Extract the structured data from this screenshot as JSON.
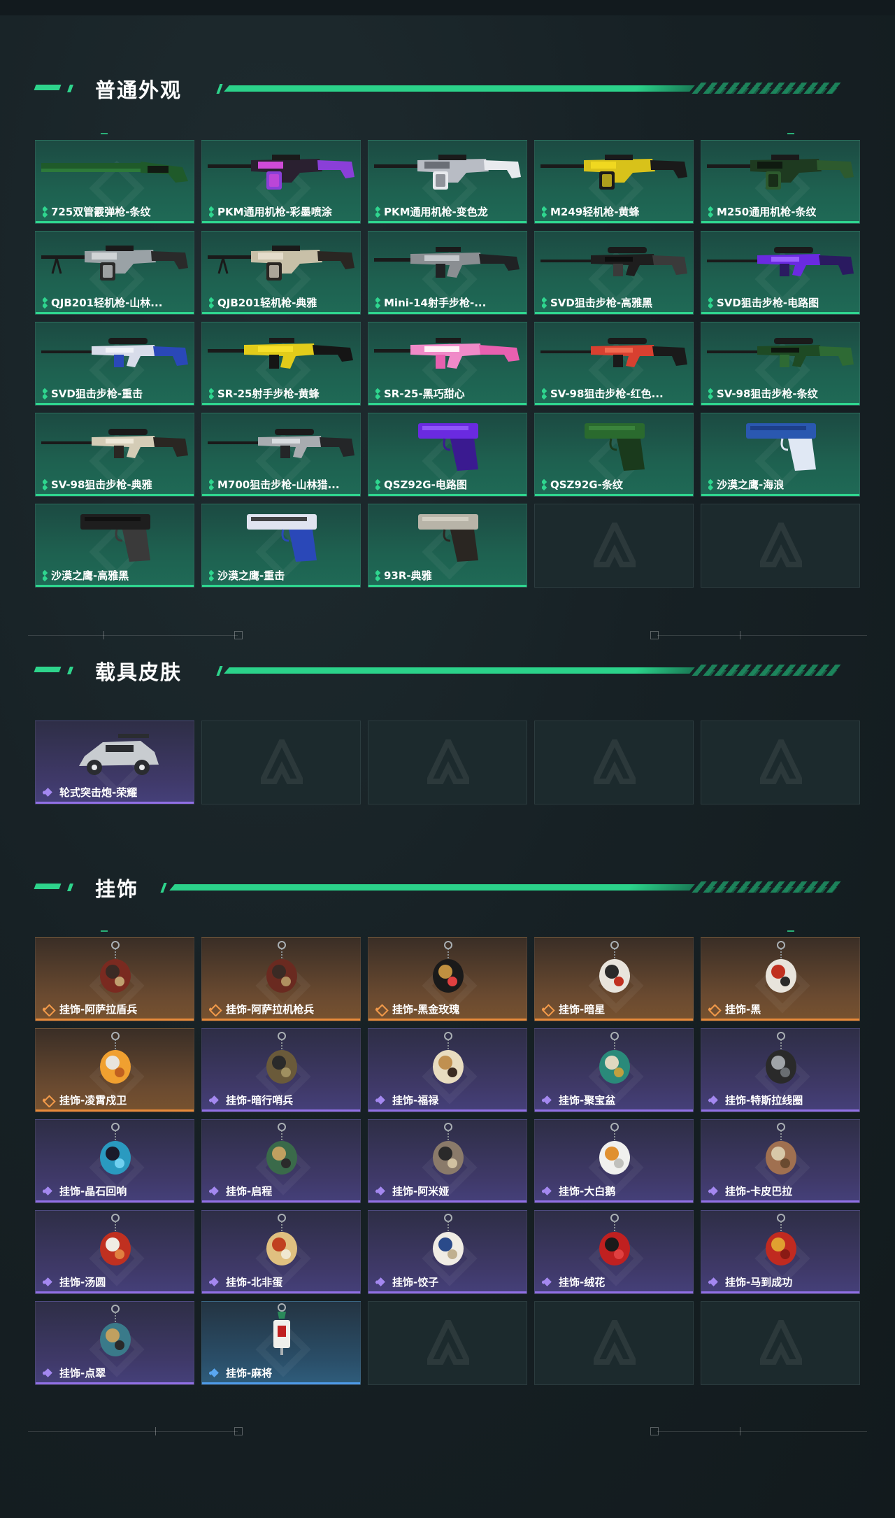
{
  "sections": {
    "weapons": {
      "title": "普通外观",
      "items": [
        {
          "label": "725双管霰弹枪-条纹",
          "type": "shotgun",
          "colors": [
            "#1f5a2a",
            "#2d7a3a",
            "#121a12"
          ]
        },
        {
          "label": "PKM通用机枪-彩墨喷涂",
          "type": "mg",
          "colors": [
            "#2a2030",
            "#8a3fd8",
            "#d04ad8"
          ]
        },
        {
          "label": "PKM通用机枪-变色龙",
          "type": "mg",
          "colors": [
            "#b8bcc4",
            "#e8eaee",
            "#6a6e76"
          ]
        },
        {
          "label": "M249轻机枪-黄蜂",
          "type": "mg",
          "colors": [
            "#d8c21a",
            "#1a1a1a",
            "#f0d820"
          ]
        },
        {
          "label": "M250通用机枪-条纹",
          "type": "mg",
          "colors": [
            "#1e3a20",
            "#2d5a2e",
            "#0f1a10"
          ]
        },
        {
          "label": "QJB201轻机枪-山林...",
          "type": "lmg",
          "colors": [
            "#9aa2a6",
            "#2a2a2a",
            "#d0d4d6"
          ]
        },
        {
          "label": "QJB201轻机枪-典雅",
          "type": "lmg",
          "colors": [
            "#c8c0a8",
            "#2a2622",
            "#e4dccb"
          ]
        },
        {
          "label": "Mini-14射手步枪-...",
          "type": "rifle",
          "colors": [
            "#8a8e92",
            "#202224",
            "#c4c8cc"
          ]
        },
        {
          "label": "SVD狙击步枪-高雅黑",
          "type": "sniper",
          "colors": [
            "#1e1e1e",
            "#3a3a3a",
            "#0e0e0e"
          ]
        },
        {
          "label": "SVD狙击步枪-电路图",
          "type": "sniper",
          "colors": [
            "#6a2ae0",
            "#2a1a60",
            "#9a60ff"
          ]
        },
        {
          "label": "SVD狙击步枪-重击",
          "type": "sniper",
          "colors": [
            "#d8dcea",
            "#2a48b8",
            "#f0f2f8"
          ]
        },
        {
          "label": "SR-25射手步枪-黄蜂",
          "type": "rifle",
          "colors": [
            "#e2cc1a",
            "#151515",
            "#f6e02a"
          ]
        },
        {
          "label": "SR-25-黑巧甜心",
          "type": "rifle",
          "colors": [
            "#f08ac8",
            "#e860b0",
            "#fff0f6"
          ]
        },
        {
          "label": "SV-98狙击步枪-红色...",
          "type": "sniper",
          "colors": [
            "#d84030",
            "#1a1a1a",
            "#f06a50"
          ]
        },
        {
          "label": "SV-98狙击步枪-条纹",
          "type": "sniper",
          "colors": [
            "#1e4a24",
            "#2e6a34",
            "#0e160e"
          ]
        },
        {
          "label": "SV-98狙击步枪-典雅",
          "type": "sniper",
          "colors": [
            "#d4ccb6",
            "#2a2622",
            "#eee8d8"
          ]
        },
        {
          "label": "M700狙击步枪-山林猎...",
          "type": "sniper",
          "colors": [
            "#a8acb0",
            "#242628",
            "#d8dcdf"
          ]
        },
        {
          "label": "QSZ92G-电路图",
          "type": "pistol",
          "colors": [
            "#6a2ae0",
            "#3a1a90",
            "#9a60ff"
          ]
        },
        {
          "label": "QSZ92G-条纹",
          "type": "pistol",
          "colors": [
            "#2a6a2e",
            "#1a3a1c",
            "#3e8a40"
          ]
        },
        {
          "label": "沙漠之鹰-海浪",
          "type": "deagle",
          "colors": [
            "#2a58b0",
            "#e0e8f4",
            "#1a3a80"
          ]
        },
        {
          "label": "沙漠之鹰-高雅黑",
          "type": "deagle",
          "colors": [
            "#1e1e1e",
            "#3a3a3a",
            "#0e0e0e"
          ]
        },
        {
          "label": "沙漠之鹰-重击",
          "type": "deagle",
          "colors": [
            "#e0e4f0",
            "#2a48b8",
            "#1a1a1a"
          ]
        },
        {
          "label": "93R-典雅",
          "type": "pistol",
          "colors": [
            "#b8b4a8",
            "#2a2622",
            "#d8d4c8"
          ]
        }
      ],
      "empty_slots": 2
    },
    "vehicles": {
      "title": "载具皮肤",
      "items": [
        {
          "label": "轮式突击炮-荣耀",
          "type": "vehicle",
          "colors": [
            "#c8ccd0",
            "#2a2c30",
            "#e8eaec"
          ]
        }
      ],
      "empty_slots": 4
    },
    "charms": {
      "title": "挂饰",
      "items": [
        {
          "label": "挂饰-阿萨拉盾兵",
          "rarity": "orange",
          "type": "charm",
          "colors": [
            "#7a2a20",
            "#3a2a24",
            "#c0a070"
          ]
        },
        {
          "label": "挂饰-阿萨拉机枪兵",
          "rarity": "orange",
          "type": "charm",
          "colors": [
            "#6a2a20",
            "#3a2a24",
            "#b09060"
          ]
        },
        {
          "label": "挂饰-黑金玫瑰",
          "rarity": "orange",
          "type": "charm",
          "colors": [
            "#1a1a1a",
            "#c09040",
            "#e04040"
          ]
        },
        {
          "label": "挂饰-暗星",
          "rarity": "orange",
          "type": "charm",
          "colors": [
            "#e8e4dc",
            "#2a2a2a",
            "#c03020"
          ]
        },
        {
          "label": "挂饰-黑",
          "rarity": "orange",
          "type": "charm",
          "colors": [
            "#e8e4dc",
            "#c03020",
            "#2a2a2a"
          ]
        },
        {
          "label": "挂饰-凌霄戍卫",
          "rarity": "orange",
          "type": "charm",
          "colors": [
            "#f0a030",
            "#e8e4dc",
            "#c06020"
          ]
        },
        {
          "label": "挂饰-暗行哨兵",
          "rarity": "purple",
          "type": "charm",
          "colors": [
            "#6a5a3a",
            "#2a2a2a",
            "#a09060"
          ]
        },
        {
          "label": "挂饰-福禄",
          "rarity": "purple",
          "type": "charm",
          "colors": [
            "#e8dcc0",
            "#c09050",
            "#3a2a20"
          ]
        },
        {
          "label": "挂饰-聚宝盆",
          "rarity": "purple",
          "type": "charm",
          "colors": [
            "#2a8a7a",
            "#e0d8c0",
            "#c0a040"
          ]
        },
        {
          "label": "挂饰-特斯拉线圈",
          "rarity": "purple",
          "type": "charm",
          "colors": [
            "#2a2a2a",
            "#a0a4a8",
            "#6a6e72"
          ]
        },
        {
          "label": "挂饰-晶石回响",
          "rarity": "purple",
          "type": "charm",
          "colors": [
            "#2a9ac0",
            "#1a1a2a",
            "#70d0f0"
          ]
        },
        {
          "label": "挂饰-启程",
          "rarity": "purple",
          "type": "charm",
          "colors": [
            "#3a6a4a",
            "#c0a060",
            "#2a2a2a"
          ]
        },
        {
          "label": "挂饰-阿米娅",
          "rarity": "purple",
          "type": "charm",
          "colors": [
            "#8a7a6a",
            "#2a2a2a",
            "#d0c0a0"
          ]
        },
        {
          "label": "挂饰-大白鹅",
          "rarity": "purple",
          "type": "charm",
          "colors": [
            "#f0f0ee",
            "#e09030",
            "#c0c0bc"
          ]
        },
        {
          "label": "挂饰-卡皮巴拉",
          "rarity": "purple",
          "type": "charm",
          "colors": [
            "#a07050",
            "#d8c8a8",
            "#6a4a30"
          ]
        },
        {
          "label": "挂饰-汤圆",
          "rarity": "purple",
          "type": "charm",
          "colors": [
            "#c03020",
            "#f0ece4",
            "#e08040"
          ]
        },
        {
          "label": "挂饰-北非蛋",
          "rarity": "purple",
          "type": "charm",
          "colors": [
            "#e0c080",
            "#c04020",
            "#f0e8d0"
          ]
        },
        {
          "label": "挂饰-饺子",
          "rarity": "purple",
          "type": "charm",
          "colors": [
            "#f0ece4",
            "#2a4a8a",
            "#c0b090"
          ]
        },
        {
          "label": "挂饰-绒花",
          "rarity": "purple",
          "type": "charm",
          "colors": [
            "#c02020",
            "#1a1a1a",
            "#e04040"
          ]
        },
        {
          "label": "挂饰-马到成功",
          "rarity": "purple",
          "type": "charm",
          "colors": [
            "#c02a20",
            "#e0a030",
            "#8a1a14"
          ]
        },
        {
          "label": "挂饰-点翠",
          "rarity": "purple",
          "type": "charm",
          "colors": [
            "#3a7a8a",
            "#c0a060",
            "#2a2a2a"
          ]
        },
        {
          "label": "挂饰-麻将",
          "rarity": "blue",
          "type": "mahjong",
          "colors": [
            "#f0f0ec",
            "#c02020",
            "#2a8a5a"
          ]
        }
      ],
      "empty_slots": 3
    }
  }
}
